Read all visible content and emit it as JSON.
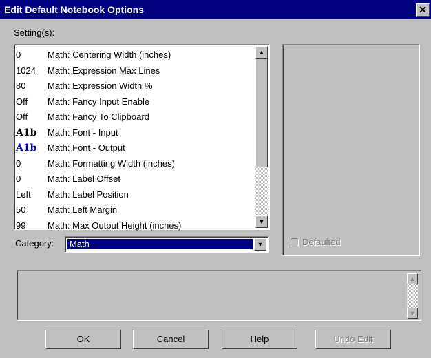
{
  "window": {
    "title": "Edit Default Notebook Options",
    "close_glyph": "✕"
  },
  "settings": {
    "label": "Setting(s):",
    "items": [
      {
        "value": "0",
        "name": "Math: Centering Width (inches)"
      },
      {
        "value": "1024",
        "name": "Math: Expression Max Lines"
      },
      {
        "value": "80",
        "name": "Math: Expression Width %"
      },
      {
        "value": "Off",
        "name": "Math: Fancy Input Enable"
      },
      {
        "value": "Off",
        "name": "Math: Fancy To Clipboard"
      },
      {
        "value": "A1b",
        "name": "Math: Font - Input",
        "style": "font"
      },
      {
        "value": "A1b",
        "name": "Math: Font - Output",
        "style": "font-blue"
      },
      {
        "value": "0",
        "name": "Math: Formatting Width (inches)"
      },
      {
        "value": "0",
        "name": "Math: Label Offset"
      },
      {
        "value": "Left",
        "name": "Math: Label Position"
      },
      {
        "value": "50",
        "name": "Math: Left Margin"
      },
      {
        "value": "99",
        "name": "Math: Max Output Height (inches)"
      }
    ]
  },
  "icons": {
    "scroll_up": "▲",
    "scroll_down": "▼",
    "combo_arrow": "▼"
  },
  "defaulted": {
    "label": "Defaulted",
    "checked": false
  },
  "category": {
    "label": "Category:",
    "value": "Math"
  },
  "buttons": {
    "ok": "OK",
    "cancel": "Cancel",
    "help": "Help",
    "undo": "Undo Edit"
  },
  "colors": {
    "title_bar": "#000080",
    "face": "#c0c0c0",
    "selection": "#000080",
    "font_output": "#0000c0"
  }
}
